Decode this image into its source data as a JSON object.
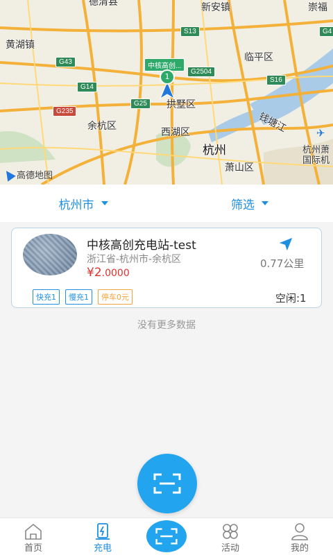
{
  "map": {
    "labels": {
      "deqing": "德清县",
      "xinanzhen": "新安镇",
      "chongfu": "崇福",
      "huanghuzhen": "黄湖镇",
      "linpingqu": "临平区",
      "gongshuqu": "拱墅区",
      "yuhangqu": "余杭区",
      "xihuqu": "西湖区",
      "hangzhou": "杭州",
      "qiantangjiang": "钱塘江",
      "xiaoshanqu": "萧山区",
      "airport_line1": "杭州萧",
      "airport_line2": "国际机"
    },
    "roads": {
      "g43": "G43",
      "g14": "G14",
      "g235": "G235",
      "g25": "G25",
      "s13": "S13",
      "g2504": "G2504",
      "s16": "S16",
      "g4": "G4"
    },
    "marker_label": "中核高创...",
    "marker_count": "1",
    "logo_text": "高德地图"
  },
  "filters": {
    "city": "杭州市",
    "filter": "筛选"
  },
  "station": {
    "name": "中核高创充电站-test",
    "address": "浙江省-杭州市-余杭区",
    "price_symbol": "¥",
    "price_int": "2",
    "price_dec": ".0000",
    "distance": "0.77公里",
    "tags": [
      "快充1",
      "慢充1",
      "停车0元"
    ],
    "free": "空闲:1"
  },
  "list_end": "没有更多数据",
  "tabs": {
    "home": "首页",
    "charge": "充电",
    "activity": "活动",
    "mine": "我的"
  },
  "colors": {
    "accent": "#1f8fe0",
    "fab": "#22a4ee",
    "price": "#e0312c",
    "parking_tag": "#f2a33a"
  }
}
